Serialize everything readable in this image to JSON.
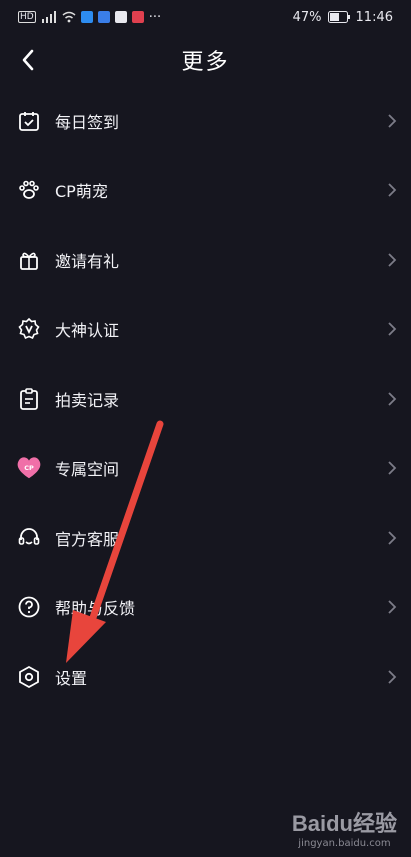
{
  "status_bar": {
    "battery": "47%",
    "time": "11:46"
  },
  "header": {
    "title": "更多"
  },
  "menu": [
    {
      "label": "每日签到",
      "icon": "calendar-check-icon"
    },
    {
      "label": "CP萌宠",
      "icon": "paw-icon"
    },
    {
      "label": "邀请有礼",
      "icon": "gift-icon"
    },
    {
      "label": "大神认证",
      "icon": "verified-badge-icon"
    },
    {
      "label": "拍卖记录",
      "icon": "clipboard-icon"
    },
    {
      "label": "专属空间",
      "icon": "cp-heart-icon"
    },
    {
      "label": "官方客服",
      "icon": "headset-icon"
    },
    {
      "label": "帮助与反馈",
      "icon": "help-circle-icon"
    },
    {
      "label": "设置",
      "icon": "settings-hexagon-icon"
    }
  ],
  "watermark": {
    "brand": "Baidu经验",
    "url": "jingyan.baidu.com"
  },
  "colors": {
    "background": "#16161f",
    "arrow": "#e8453c",
    "accent_pink": "#f06fa8"
  }
}
